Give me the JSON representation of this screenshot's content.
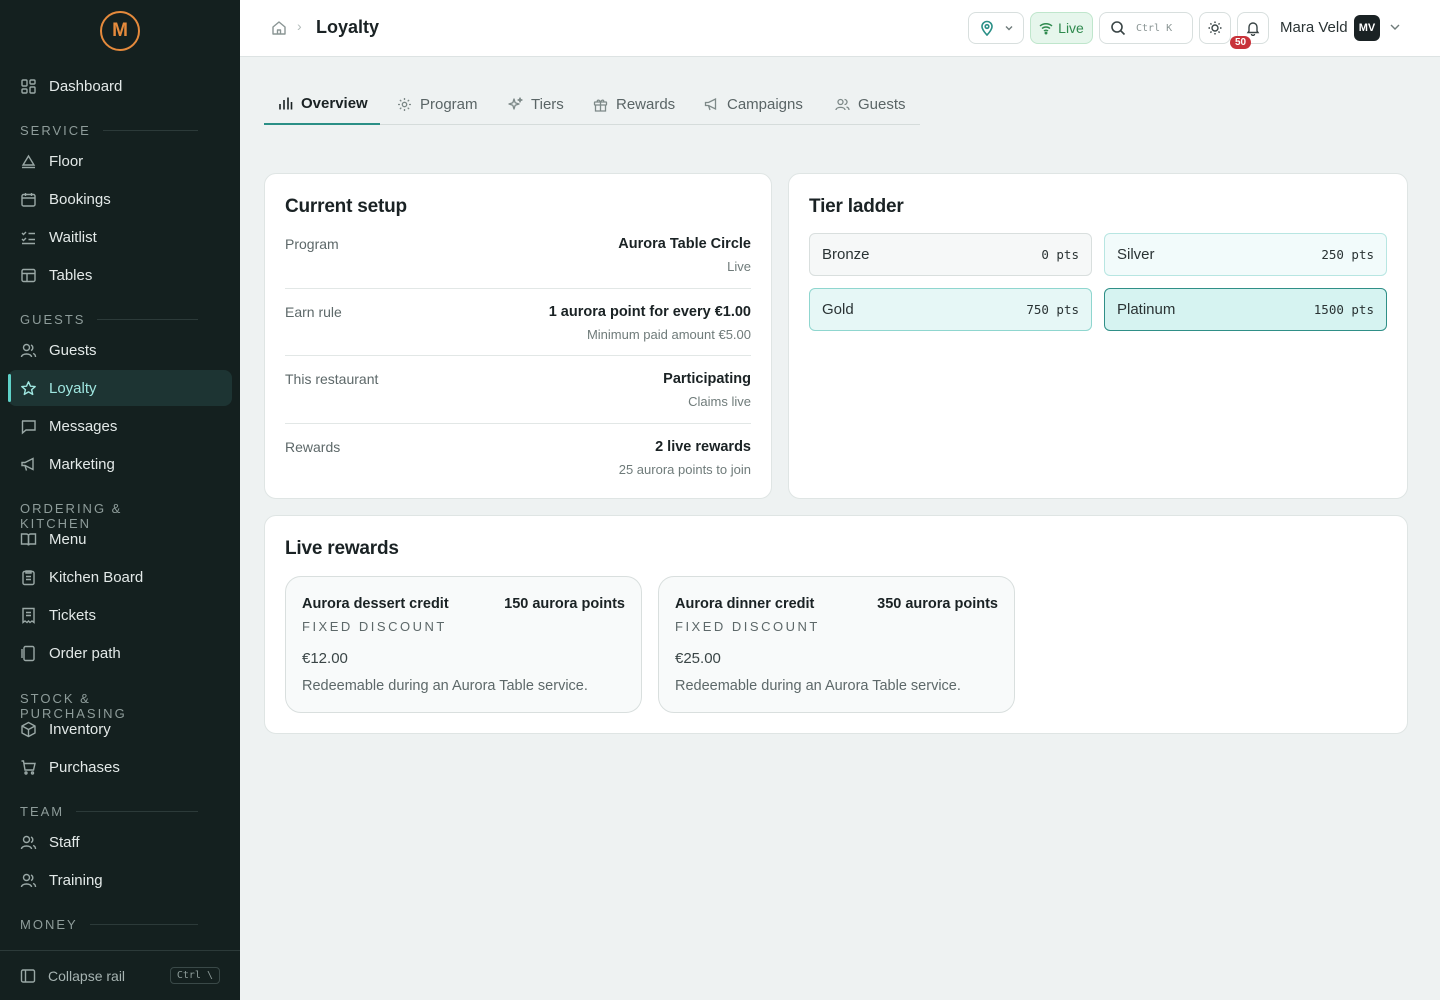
{
  "brand": {
    "logo_text": "M",
    "accent": "#e58a3c"
  },
  "sidebar": {
    "dashboard": "Dashboard",
    "sections": {
      "service": "SERVICE",
      "guests": "GUESTS",
      "ordering": "ORDERING & KITCHEN",
      "stock": "STOCK & PURCHASING",
      "team": "TEAM",
      "money": "MONEY"
    },
    "items": {
      "floor": "Floor",
      "bookings": "Bookings",
      "waitlist": "Waitlist",
      "tables": "Tables",
      "guests": "Guests",
      "loyalty": "Loyalty",
      "messages": "Messages",
      "marketing": "Marketing",
      "menu": "Menu",
      "kitchen_board": "Kitchen Board",
      "tickets": "Tickets",
      "order_path": "Order path",
      "inventory": "Inventory",
      "purchases": "Purchases",
      "staff": "Staff",
      "training": "Training"
    },
    "active": "loyalty",
    "collapse_label": "Collapse rail",
    "collapse_shortcut": "Ctrl \\"
  },
  "header": {
    "breadcrumb_title": "Loyalty",
    "live_label": "Live",
    "search_shortcut": "Ctrl K",
    "notification_count": "50",
    "user_name": "Mara Veld",
    "user_initials": "MV"
  },
  "tabs": {
    "overview": "Overview",
    "program": "Program",
    "tiers": "Tiers",
    "rewards": "Rewards",
    "campaigns": "Campaigns",
    "guests": "Guests",
    "active": "overview"
  },
  "current_setup": {
    "title": "Current setup",
    "rows": [
      {
        "label": "Program",
        "value": "Aurora Table Circle",
        "sub": "Live"
      },
      {
        "label": "Earn rule",
        "value": "1 aurora point for every €1.00",
        "sub": "Minimum paid amount €5.00"
      },
      {
        "label": "This restaurant",
        "value": "Participating",
        "sub": "Claims live"
      },
      {
        "label": "Rewards",
        "value": "2 live rewards",
        "sub": "25 aurora points to join"
      }
    ]
  },
  "tier_ladder": {
    "title": "Tier ladder",
    "tiers": [
      {
        "name": "Bronze",
        "points": "0 pts"
      },
      {
        "name": "Silver",
        "points": "250 pts"
      },
      {
        "name": "Gold",
        "points": "750 pts"
      },
      {
        "name": "Platinum",
        "points": "1500 pts"
      }
    ]
  },
  "live_rewards": {
    "title": "Live rewards",
    "items": [
      {
        "name": "Aurora dessert credit",
        "points": "150 aurora points",
        "type": "FIXED DISCOUNT",
        "amount": "€12.00",
        "description": "Redeemable during an Aurora Table service."
      },
      {
        "name": "Aurora dinner credit",
        "points": "350 aurora points",
        "type": "FIXED DISCOUNT",
        "amount": "€25.00",
        "description": "Redeemable during an Aurora Table service."
      }
    ]
  }
}
